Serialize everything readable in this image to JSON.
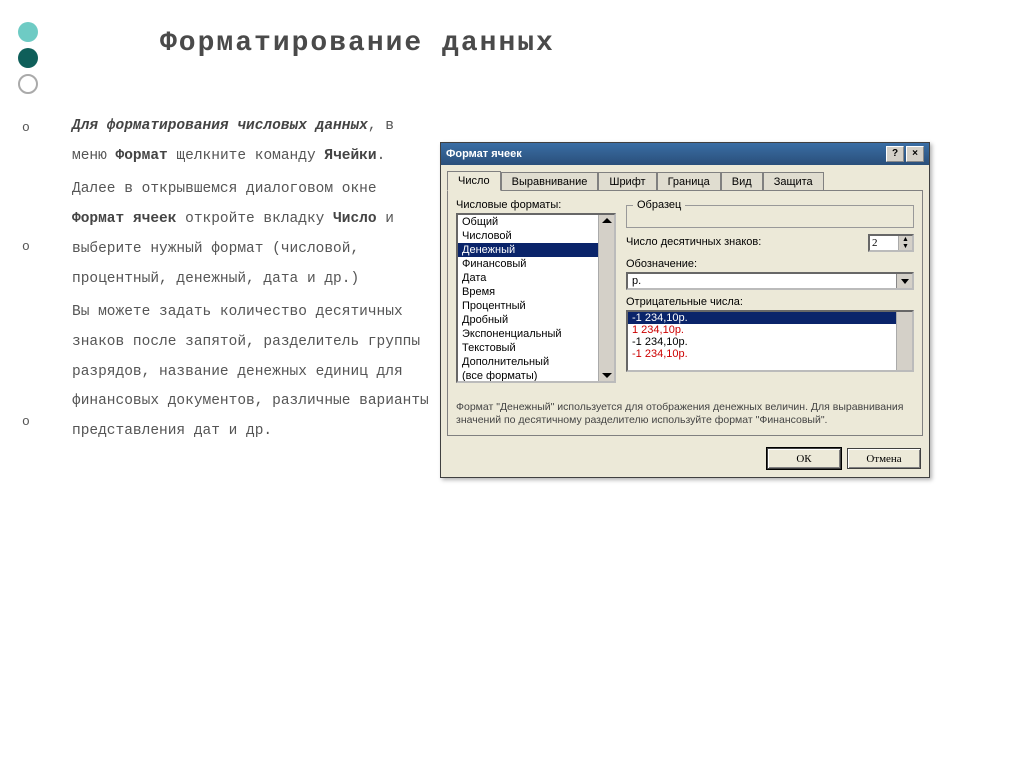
{
  "slide": {
    "title": "Форматирование данных",
    "bullets": [
      "o",
      "o",
      "o"
    ],
    "para1_a": "Для форматирования числовых данных",
    "para1_b": ", в меню ",
    "para1_c": "Формат",
    "para1_d": " щелкните команду ",
    "para1_e": "Ячейки",
    "para1_f": ".",
    "para2_a": "Далее в открывшемся диалоговом окне ",
    "para2_b": "Формат ячеек",
    "para2_c": " откройте вкладку ",
    "para2_d": "Число",
    "para2_e": " и выберите нужный формат (числовой, процентный, денежный, дата и др.)",
    "para3": "Вы можете задать количество десятичных знаков после запятой, разделитель группы разрядов, название денежных единиц для финансовых документов, различные варианты представления дат и др."
  },
  "dialog": {
    "title": "Формат ячеек",
    "help": "?",
    "close": "×",
    "tabs": [
      "Число",
      "Выравнивание",
      "Шрифт",
      "Граница",
      "Вид",
      "Защита"
    ],
    "numFormatsLabel": "Числовые форматы:",
    "formats": [
      "Общий",
      "Числовой",
      "Денежный",
      "Финансовый",
      "Дата",
      "Время",
      "Процентный",
      "Дробный",
      "Экспоненциальный",
      "Текстовый",
      "Дополнительный",
      "(все форматы)"
    ],
    "selectedFormatIndex": 2,
    "sampleLegend": "Образец",
    "decimalsLabel": "Число десятичных знаков:",
    "decimalsValue": "2",
    "symbolLabel": "Обозначение:",
    "symbolValue": "р.",
    "negLabel": "Отрицательные числа:",
    "negItems": [
      {
        "text": "-1 234,10р.",
        "red": false,
        "selected": true
      },
      {
        "text": "1 234,10р.",
        "red": true,
        "selected": false
      },
      {
        "text": "-1 234,10р.",
        "red": false,
        "selected": false
      },
      {
        "text": "-1 234,10р.",
        "red": true,
        "selected": false
      }
    ],
    "description": "Формат \"Денежный\" используется для отображения денежных величин. Для выравнивания значений по десятичному разделителю используйте формат \"Финансовый\".",
    "ok": "ОК",
    "cancel": "Отмена"
  }
}
